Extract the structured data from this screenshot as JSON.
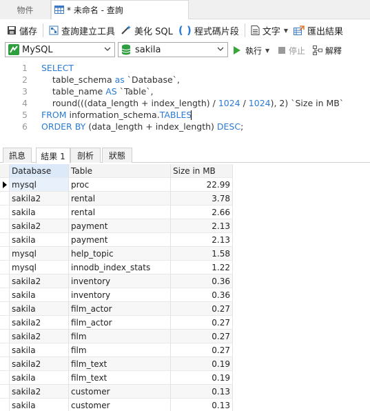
{
  "tabs": {
    "objects": "物件",
    "query": "* 未命名 - 查詢"
  },
  "toolbar": {
    "save": "儲存",
    "query_builder": "查詢建立工具",
    "beautify_sql": "美化 SQL",
    "code_snippet": "程式碼片段",
    "text": "文字",
    "export_results": "匯出結果"
  },
  "connection": {
    "server": "MySQL",
    "database": "sakila",
    "run": "執行",
    "stop": "停止",
    "explain": "解釋"
  },
  "editor": {
    "line_numbers": [
      "1",
      "2",
      "3",
      "4",
      "5",
      "6"
    ]
  },
  "result_tabs": [
    "訊息",
    "結果 1",
    "剖析",
    "狀態"
  ],
  "grid": {
    "headers": [
      "Database",
      "Table",
      "Size in MB"
    ],
    "rows": [
      [
        "mysql",
        "proc",
        "22.99"
      ],
      [
        "sakila2",
        "rental",
        "3.78"
      ],
      [
        "sakila",
        "rental",
        "2.66"
      ],
      [
        "sakila2",
        "payment",
        "2.13"
      ],
      [
        "sakila",
        "payment",
        "2.13"
      ],
      [
        "mysql",
        "help_topic",
        "1.58"
      ],
      [
        "mysql",
        "innodb_index_stats",
        "1.22"
      ],
      [
        "sakila2",
        "inventory",
        "0.36"
      ],
      [
        "sakila",
        "inventory",
        "0.36"
      ],
      [
        "sakila",
        "film_actor",
        "0.27"
      ],
      [
        "sakila2",
        "film_actor",
        "0.27"
      ],
      [
        "sakila2",
        "film",
        "0.27"
      ],
      [
        "sakila",
        "film",
        "0.27"
      ],
      [
        "sakila2",
        "film_text",
        "0.19"
      ],
      [
        "sakila",
        "film_text",
        "0.19"
      ],
      [
        "sakila2",
        "customer",
        "0.13"
      ],
      [
        "sakila",
        "customer",
        "0.13"
      ]
    ]
  },
  "colors": {
    "keyword": "#2a7bd6",
    "run_green": "#3aa53a",
    "db_green": "#2e9e3e"
  }
}
